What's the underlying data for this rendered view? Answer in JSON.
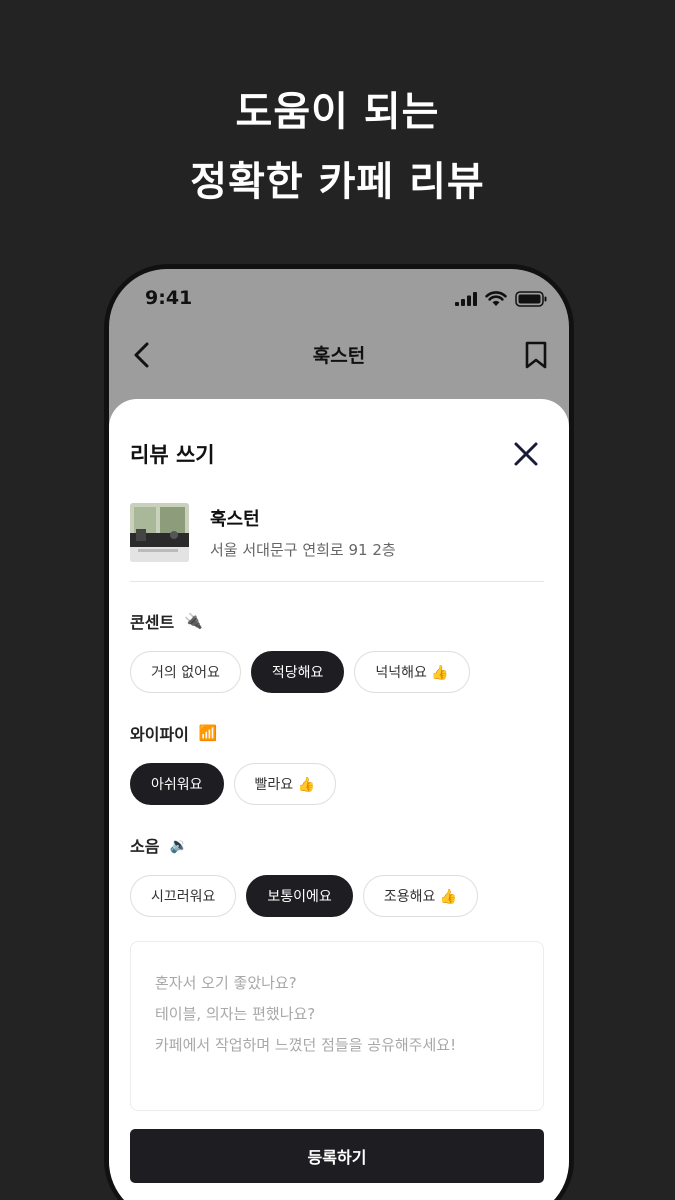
{
  "headline": {
    "line1": "도움이 되는",
    "line2": "정확한 카페 리뷰"
  },
  "status_bar": {
    "time": "9:41"
  },
  "nav": {
    "title": "훅스턴",
    "back_icon": "chevron-left-icon",
    "bookmark_icon": "bookmark-icon"
  },
  "sheet": {
    "title": "리뷰 쓰기",
    "close_icon": "close-icon",
    "cafe": {
      "name": "훅스턴",
      "address": "서울 서대문구 연희로 91 2층"
    },
    "sections": [
      {
        "label": "콘센트",
        "emoji": "🔌",
        "options": [
          {
            "label": "거의 없어요",
            "selected": false
          },
          {
            "label": "적당해요",
            "selected": true
          },
          {
            "label": "넉넉해요 👍",
            "selected": false
          }
        ]
      },
      {
        "label": "와이파이",
        "emoji": "📶",
        "options": [
          {
            "label": "아쉬워요",
            "selected": true
          },
          {
            "label": "빨라요 👍",
            "selected": false
          }
        ]
      },
      {
        "label": "소음",
        "emoji": "🔉",
        "options": [
          {
            "label": "시끄러워요",
            "selected": false
          },
          {
            "label": "보통이에요",
            "selected": true
          },
          {
            "label": "조용해요 👍",
            "selected": false
          }
        ]
      }
    ],
    "review_placeholder": [
      "혼자서 오기 좋았나요?",
      "테이블, 의자는 편했나요?",
      "카페에서 작업하며 느꼈던 점들을 공유해주세요!"
    ],
    "submit_label": "등록하기"
  },
  "colors": {
    "background": "#232323",
    "accent_dark": "#1e1e22",
    "close_icon": "#1a1a3a"
  }
}
